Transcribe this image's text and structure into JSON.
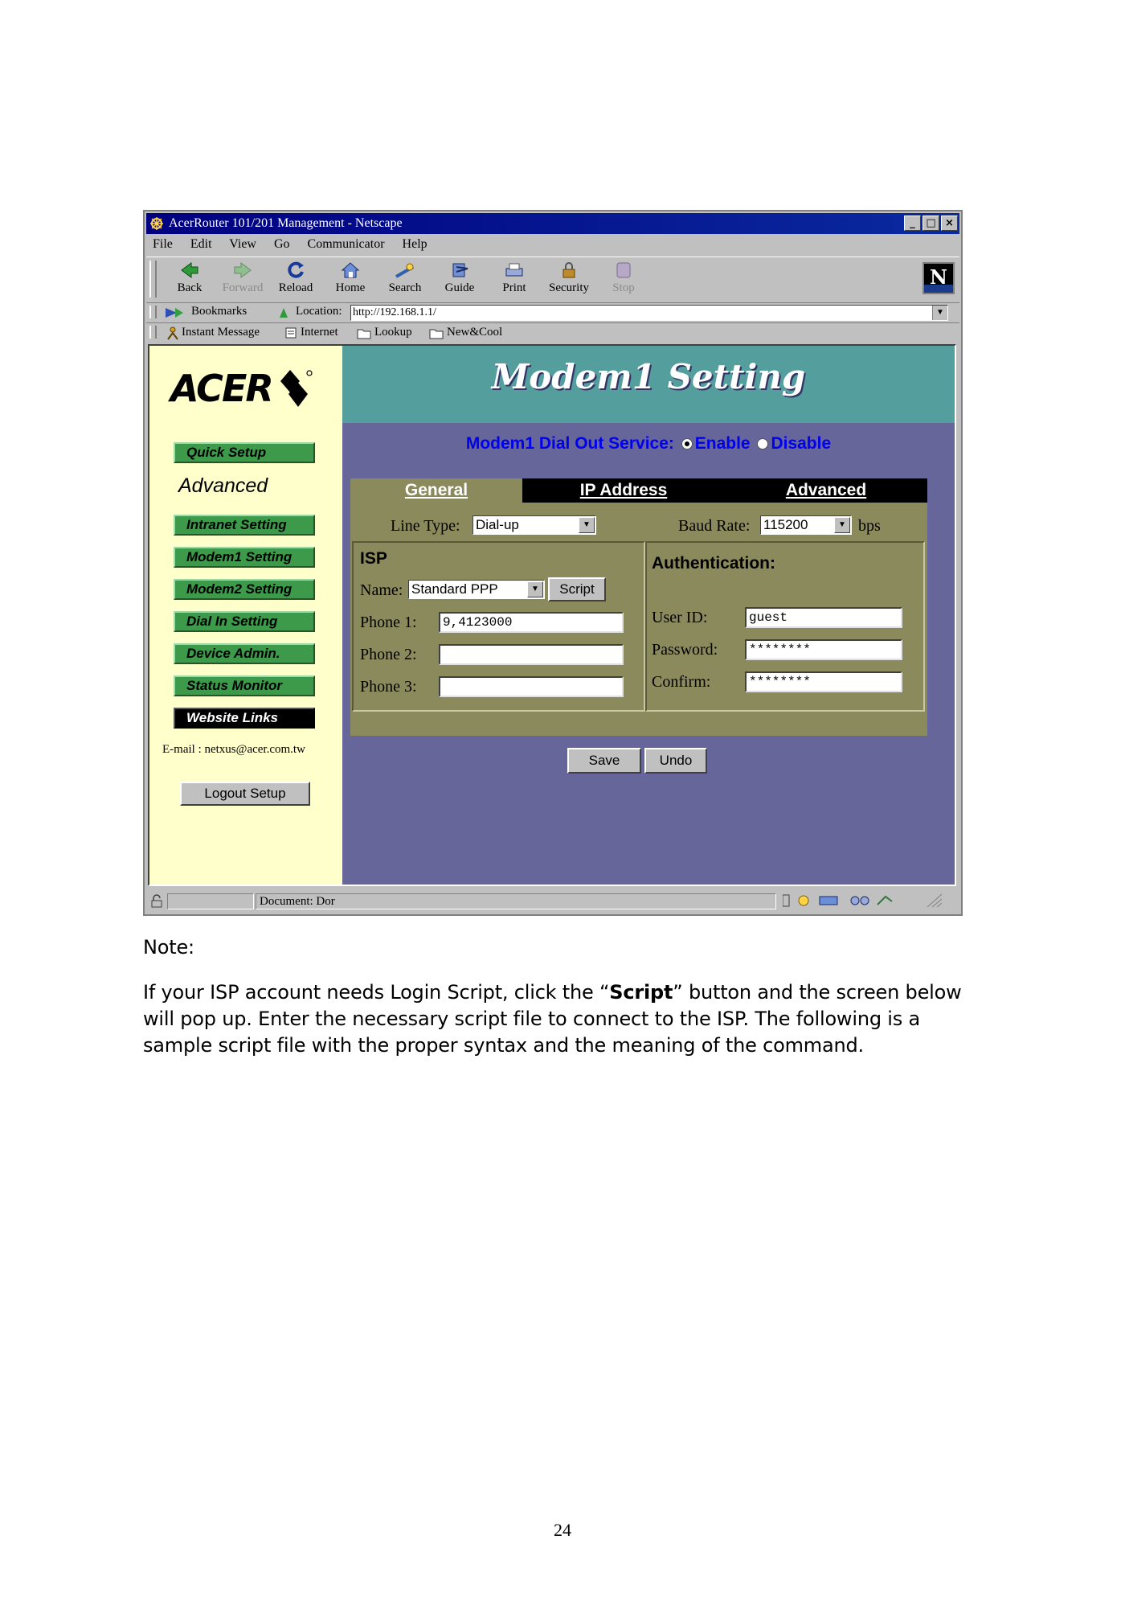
{
  "window": {
    "title": "AcerRouter 101/201 Management - Netscape",
    "controls": [
      "_",
      "□",
      "×"
    ]
  },
  "menu": [
    "File",
    "Edit",
    "View",
    "Go",
    "Communicator",
    "Help"
  ],
  "toolbar": {
    "buttons": [
      {
        "label": "Back",
        "icon": "back-arrow-icon",
        "enabled": true
      },
      {
        "label": "Forward",
        "icon": "forward-arrow-icon",
        "enabled": false
      },
      {
        "label": "Reload",
        "icon": "reload-icon",
        "enabled": true
      },
      {
        "label": "Home",
        "icon": "home-icon",
        "enabled": true
      },
      {
        "label": "Search",
        "icon": "search-icon",
        "enabled": true
      },
      {
        "label": "Guide",
        "icon": "guide-icon",
        "enabled": true
      },
      {
        "label": "Print",
        "icon": "print-icon",
        "enabled": true
      },
      {
        "label": "Security",
        "icon": "security-lock-icon",
        "enabled": true
      },
      {
        "label": "Stop",
        "icon": "stop-icon",
        "enabled": false
      }
    ]
  },
  "location": {
    "bookmarks": "Bookmarks",
    "label": "Location:",
    "url": "http://192.168.1.1/"
  },
  "personal_toolbar": [
    "Instant Message",
    "Internet",
    "Lookup",
    "New&Cool"
  ],
  "sidebar": {
    "logo": "ACER",
    "quick_setup": "Quick Setup",
    "advanced_heading": "Advanced",
    "items": [
      "Intranet Setting",
      "Modem1 Setting",
      "Modem2 Setting",
      "Dial In Setting",
      "Device Admin.",
      "Status Monitor",
      "Website Links"
    ],
    "email": "E-mail : netxus@acer.com.tw",
    "logout": "Logout Setup"
  },
  "page": {
    "title": "Modem1 Setting",
    "service_label": "Modem1 Dial Out Service:",
    "enable": "Enable",
    "disable": "Disable",
    "service_selected": "Enable",
    "tabs": [
      "General",
      "IP Address",
      "Advanced"
    ],
    "active_tab": "General",
    "line_type_label": "Line Type:",
    "line_type_value": "Dial-up",
    "baud_rate_label": "Baud Rate:",
    "baud_rate_value": "115200",
    "baud_unit": "bps",
    "isp": {
      "title": "ISP",
      "name_label": "Name:",
      "name_value": "Standard PPP",
      "script_button": "Script",
      "phone1_label": "Phone 1:",
      "phone1_value": "9,4123000",
      "phone2_label": "Phone 2:",
      "phone2_value": "",
      "phone3_label": "Phone 3:",
      "phone3_value": ""
    },
    "auth": {
      "title": "Authentication:",
      "userid_label": "User ID:",
      "userid_value": "guest",
      "password_label": "Password:",
      "password_value": "********",
      "confirm_label": "Confirm:",
      "confirm_value": "********"
    },
    "save": "Save",
    "undo": "Undo"
  },
  "statusbar": {
    "text": "Document: Dor"
  },
  "document": {
    "note": "Note:",
    "para_before": "If your ISP account needs Login Script, click the “",
    "para_bold": "Script",
    "para_after": "” button and the screen below will pop up. Enter the necessary script file to connect to the ISP. The following is a sample script file with the proper syntax and the meaning of the command.",
    "page_number": "24"
  }
}
